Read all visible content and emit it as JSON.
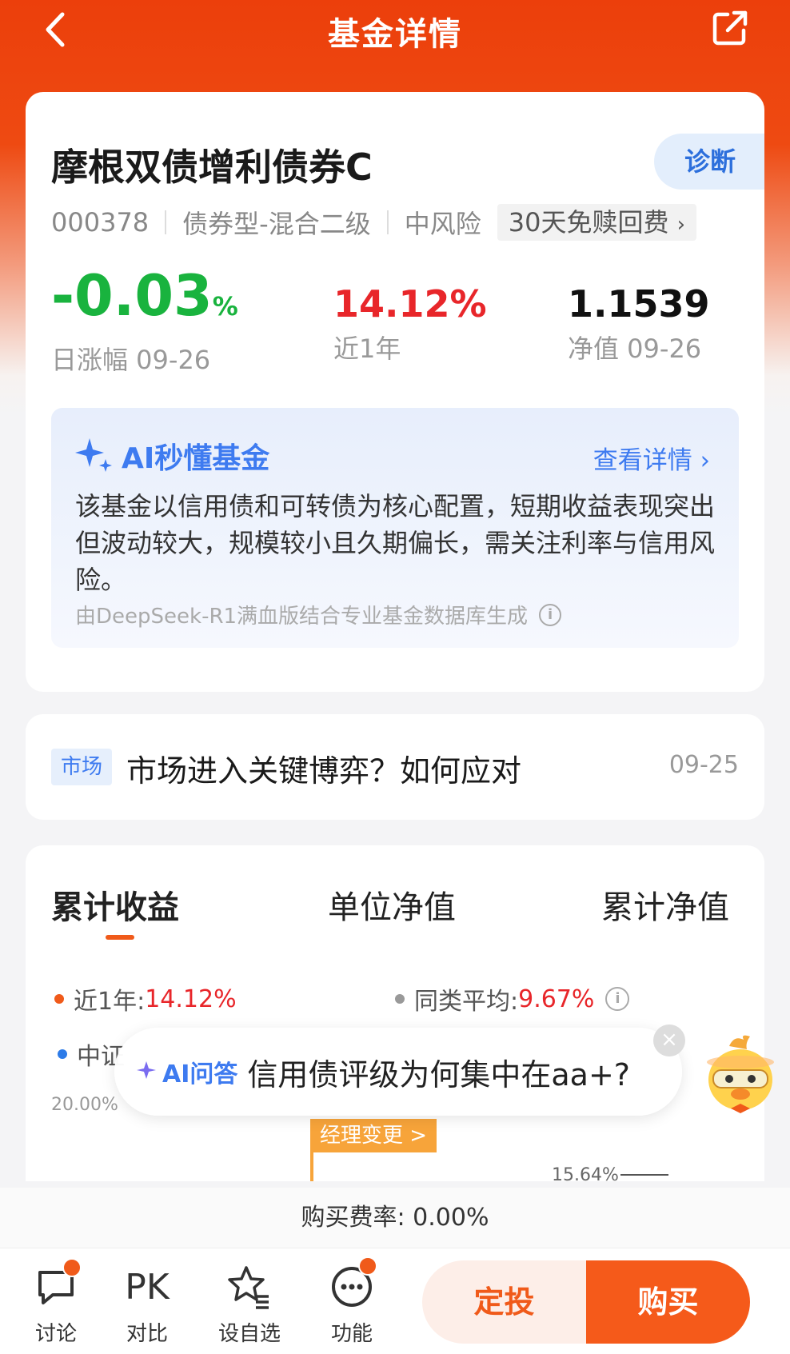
{
  "header": {
    "title": "基金详情"
  },
  "fund": {
    "name": "摩根双债增利债券C",
    "diagnose_label": "诊断",
    "code": "000378",
    "type": "债券型-混合二级",
    "risk": "中风险",
    "fee_tag": "30天免赎回费",
    "daily_change": "-0.03",
    "daily_change_unit": "%",
    "daily_change_label": "日涨幅 09-26",
    "year_return": "14.12%",
    "year_return_label": "近1年",
    "nav": "1.1539",
    "nav_label": "净值 09-26"
  },
  "ai_summary": {
    "title": "AI秒懂基金",
    "more": "查看详情",
    "text": "该基金以信用债和可转债为核心配置，短期收益表现突出但波动较大，规模较小且久期偏长，需关注利率与信用风险。",
    "source": "由DeepSeek-R1满血版结合专业基金数据库生成"
  },
  "news": {
    "tag": "市场",
    "title": "市场进入关键博弈？如何应对",
    "date": "09-25"
  },
  "chart": {
    "tabs": [
      "累计收益",
      "单位净值",
      "累计净值"
    ],
    "legend": [
      {
        "label": "近1年:",
        "value": "14.12%",
        "color": "#f05a1a"
      },
      {
        "label": "同类平均:",
        "value": "9.67%",
        "color": "#999999"
      },
      {
        "label": "中证",
        "color": "#2d7be8"
      }
    ],
    "y_top": "20.00%",
    "manager_change": "经理变更 >",
    "point_label": "15.64%"
  },
  "ai_popup": {
    "tag": "AI问答",
    "question": "信用债评级为何集中在aa+?"
  },
  "fee_rate": "购买费率: 0.00%",
  "bottom_nav": [
    {
      "label": "讨论",
      "icon": "chat-icon"
    },
    {
      "label": "对比",
      "icon": "pk-icon",
      "glyph": "PK"
    },
    {
      "label": "设自选",
      "icon": "star-list-icon"
    },
    {
      "label": "功能",
      "icon": "more-icon"
    }
  ],
  "actions": {
    "sip": "定投",
    "buy": "购买"
  },
  "colors": {
    "brand": "#ec3f0b",
    "up": "#e8262a",
    "down": "#19b33e",
    "ai_blue": "#3e7bf0"
  }
}
